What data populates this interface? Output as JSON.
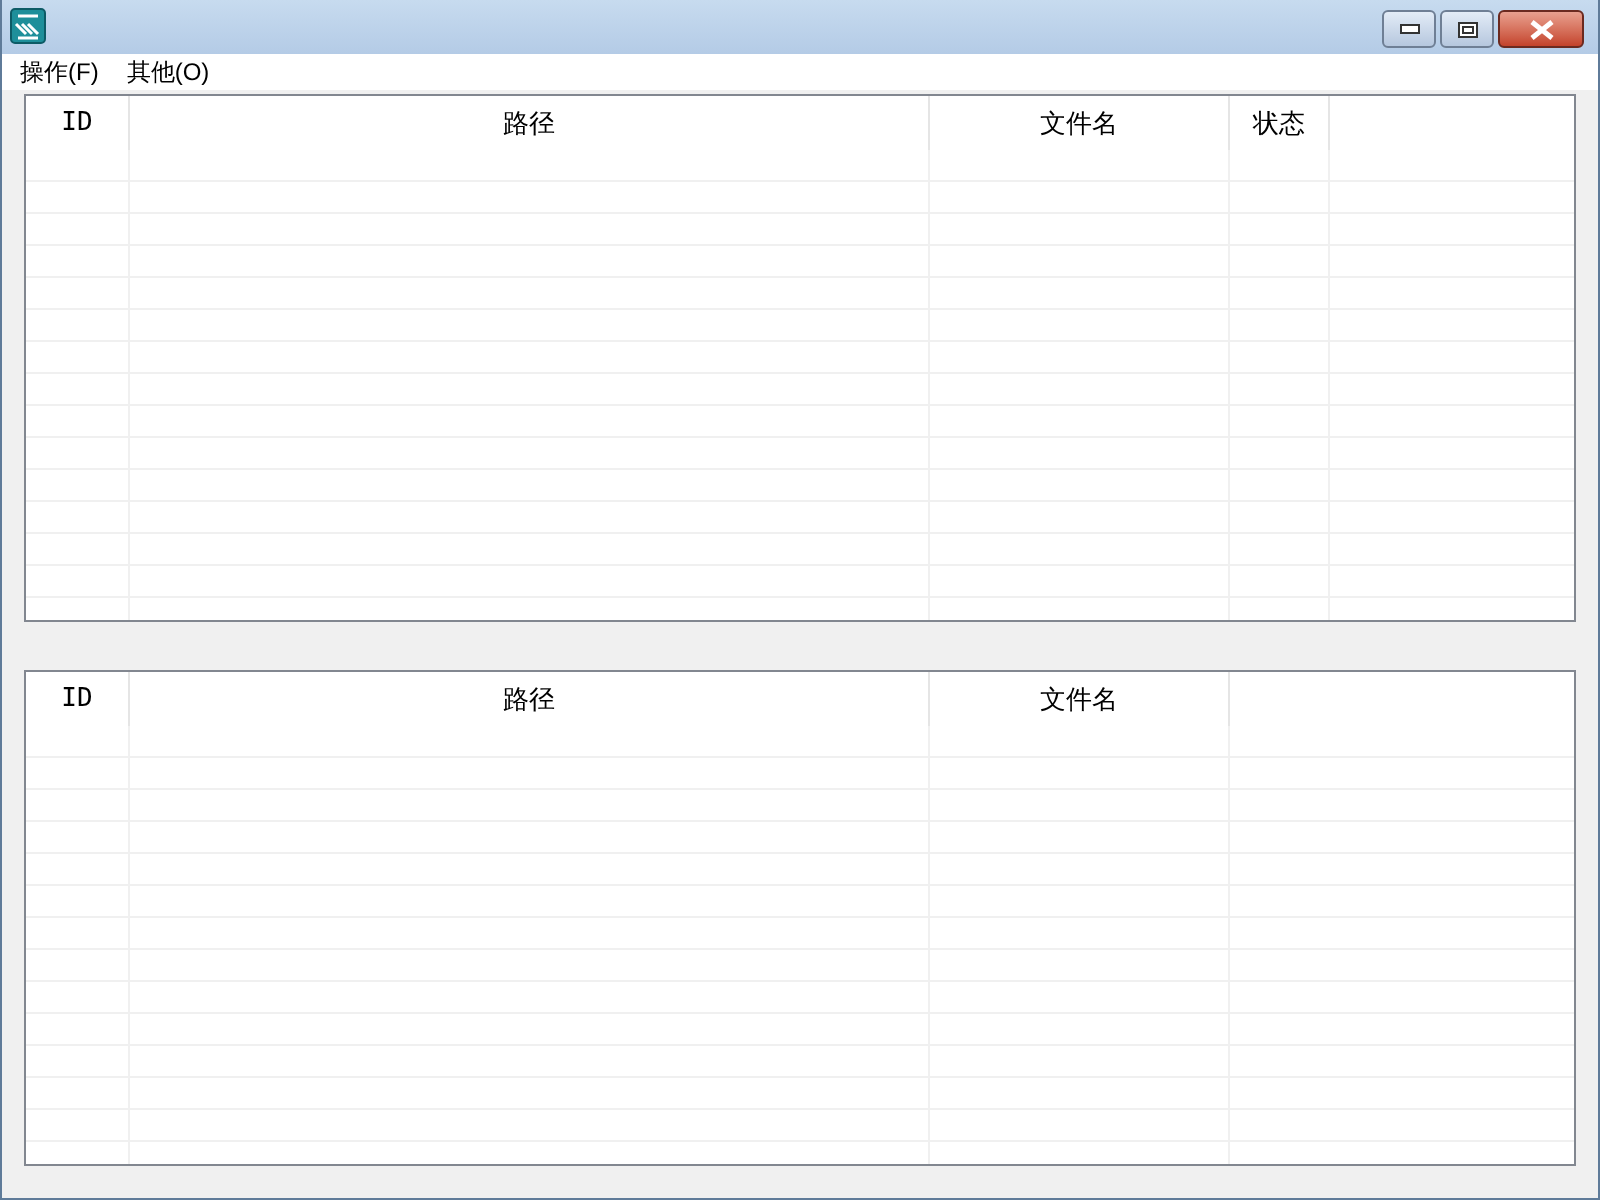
{
  "menu": [
    "操作(F)",
    "其他(O)"
  ],
  "tables": [
    {
      "columns": [
        "ID",
        "路径",
        "文件名",
        "状态"
      ]
    },
    {
      "columns": [
        "ID",
        "路径",
        "文件名"
      ]
    }
  ]
}
